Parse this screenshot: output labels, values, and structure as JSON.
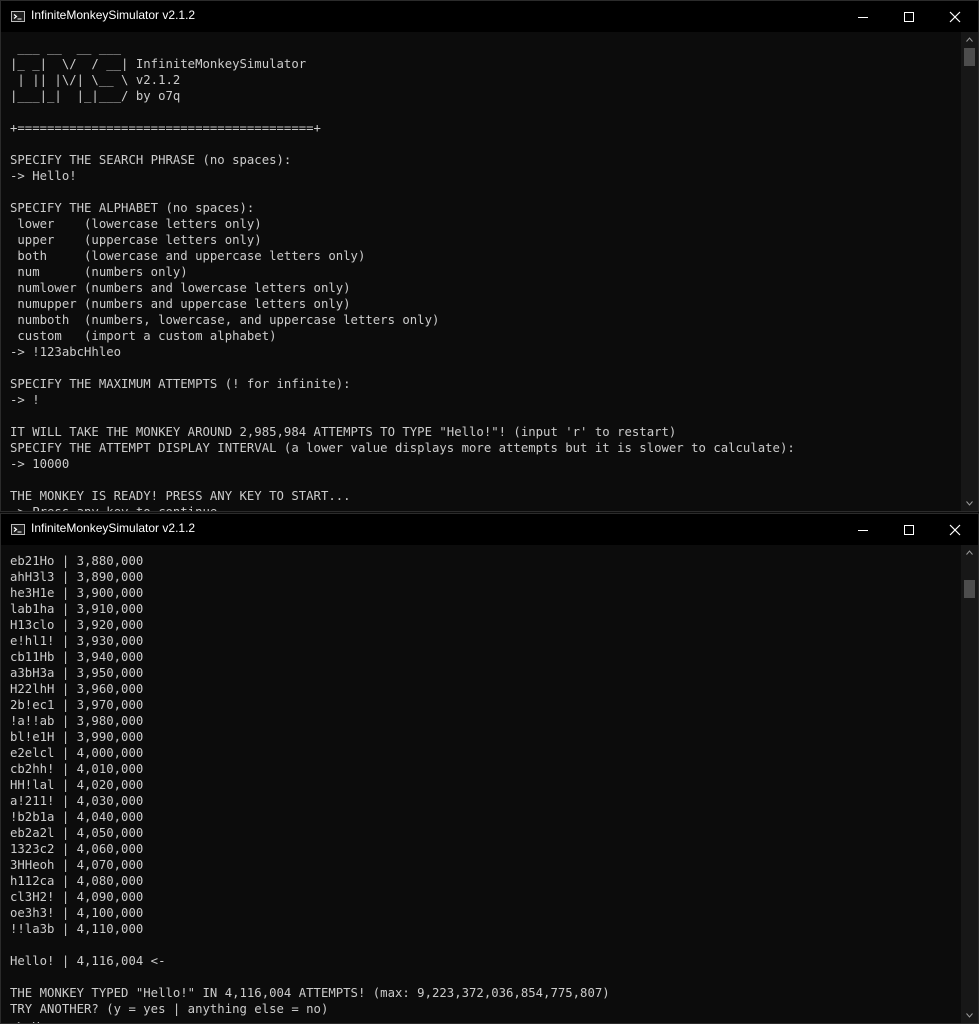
{
  "window1": {
    "title": "InfiniteMonkeySimulator v2.1.2",
    "lines": [
      " ___ __  __ ___",
      "|_ _|  \\/  / __| InfiniteMonkeySimulator",
      " | || |\\/| \\__ \\ v2.1.2",
      "|___|_|  |_|___/ by o7q",
      "",
      "+========================================+",
      "",
      "SPECIFY THE SEARCH PHRASE (no spaces):",
      "-> Hello!",
      "",
      "SPECIFY THE ALPHABET (no spaces):",
      " lower    (lowercase letters only)",
      " upper    (uppercase letters only)",
      " both     (lowercase and uppercase letters only)",
      " num      (numbers only)",
      " numlower (numbers and lowercase letters only)",
      " numupper (numbers and uppercase letters only)",
      " numboth  (numbers, lowercase, and uppercase letters only)",
      " custom   (import a custom alphabet)",
      "-> !123abcHhleo",
      "",
      "SPECIFY THE MAXIMUM ATTEMPTS (! for infinite):",
      "-> !",
      "",
      "IT WILL TAKE THE MONKEY AROUND 2,985,984 ATTEMPTS TO TYPE \"Hello!\"! (input 'r' to restart)",
      "SPECIFY THE ATTEMPT DISPLAY INTERVAL (a lower value displays more attempts but it is slower to calculate):",
      "-> 10000",
      "",
      "THE MONKEY IS READY! PRESS ANY KEY TO START...",
      "-> Press any key to continue . . ."
    ]
  },
  "window2": {
    "title": "InfiniteMonkeySimulator v2.1.2",
    "lines": [
      "eb21Ho | 3,880,000",
      "ahH3l3 | 3,890,000",
      "he3H1e | 3,900,000",
      "lab1ha | 3,910,000",
      "H13clo | 3,920,000",
      "e!hl1! | 3,930,000",
      "cb11Hb | 3,940,000",
      "a3bH3a | 3,950,000",
      "H22lhH | 3,960,000",
      "2b!ec1 | 3,970,000",
      "!a!!ab | 3,980,000",
      "bl!e1H | 3,990,000",
      "e2elcl | 4,000,000",
      "cb2hh! | 4,010,000",
      "HH!lal | 4,020,000",
      "a!211! | 4,030,000",
      "!b2b1a | 4,040,000",
      "eb2a2l | 4,050,000",
      "1323c2 | 4,060,000",
      "3HHeoh | 4,070,000",
      "h112ca | 4,080,000",
      "cl3H2! | 4,090,000",
      "oe3h3! | 4,100,000",
      "!!la3b | 4,110,000",
      "",
      "Hello! | 4,116,004 <-",
      "",
      "THE MONKEY TYPED \"Hello!\" IN 4,116,004 ATTEMPTS! (max: 9,223,372,036,854,775,807)",
      "TRY ANOTHER? (y = yes | anything else = no)",
      "-> y"
    ]
  }
}
